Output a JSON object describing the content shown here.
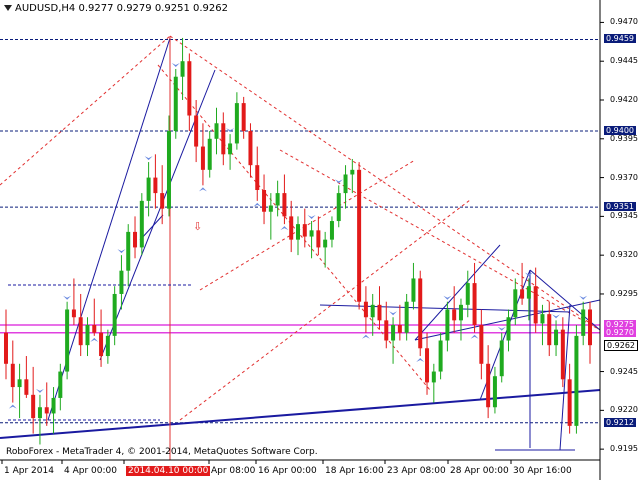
{
  "header": {
    "symbol_tf": "AUDUSD,H4",
    "ohlc": "0.9277 0.9279 0.9251 0.9262"
  },
  "footer": {
    "copyright": "RoboForex - MetaTrader 4, © 2001-2014, MetaQuotes Software Corp."
  },
  "xaxis": {
    "labels": [
      "1 Apr 2014",
      "4 Apr 00:00",
      "2014.04.10 00:00",
      "Apr 08:00",
      "16 Apr 00:00",
      "18 Apr 16:00",
      "23 Apr 08:00",
      "28 Apr 00:00",
      "30 Apr 16:00"
    ],
    "highlight_index": 2
  },
  "yaxis": {
    "ticks": [
      "0.9470",
      "0.9445",
      "0.9420",
      "0.9395",
      "0.9370",
      "0.9345",
      "0.9320",
      "0.9295",
      "0.9245",
      "0.9220",
      "0.9195"
    ],
    "levels": [
      {
        "price": "0.9459",
        "color": "#0a1c7a"
      },
      {
        "price": "0.9400",
        "color": "#0a1c7a"
      },
      {
        "price": "0.9351",
        "color": "#0a1c7a"
      },
      {
        "price": "0.9275",
        "color": "#e040e0"
      },
      {
        "price": "0.9270",
        "color": "#e040e0"
      },
      {
        "price": "0.9212",
        "color": "#0a1c7a"
      }
    ],
    "current": "0.9262"
  },
  "chart_data": {
    "type": "candlestick",
    "series": [
      {
        "name": "AUDUSD,H4",
        "ohlc": [
          [
            0.927,
            0.9285,
            0.924,
            0.925
          ],
          [
            0.925,
            0.9265,
            0.9225,
            0.9235
          ],
          [
            0.9235,
            0.925,
            0.9215,
            0.924
          ],
          [
            0.924,
            0.9255,
            0.9228,
            0.923
          ],
          [
            0.923,
            0.9248,
            0.9205,
            0.9215
          ],
          [
            0.9215,
            0.923,
            0.9198,
            0.9222
          ],
          [
            0.9222,
            0.9238,
            0.921,
            0.9218
          ],
          [
            0.9218,
            0.9235,
            0.9205,
            0.9228
          ],
          [
            0.9228,
            0.925,
            0.922,
            0.9245
          ],
          [
            0.9245,
            0.929,
            0.924,
            0.9285
          ],
          [
            0.9285,
            0.9305,
            0.9275,
            0.928
          ],
          [
            0.928,
            0.9295,
            0.9255,
            0.9262
          ],
          [
            0.9262,
            0.928,
            0.9255,
            0.9275
          ],
          [
            0.9275,
            0.9292,
            0.9268,
            0.927
          ],
          [
            0.927,
            0.9285,
            0.9248,
            0.9255
          ],
          [
            0.9255,
            0.9272,
            0.925,
            0.9268
          ],
          [
            0.9268,
            0.93,
            0.9262,
            0.9295
          ],
          [
            0.9295,
            0.932,
            0.9285,
            0.931
          ],
          [
            0.931,
            0.934,
            0.93,
            0.9335
          ],
          [
            0.9335,
            0.9345,
            0.9318,
            0.9325
          ],
          [
            0.9325,
            0.936,
            0.932,
            0.9355
          ],
          [
            0.9355,
            0.938,
            0.9345,
            0.937
          ],
          [
            0.937,
            0.9385,
            0.935,
            0.936
          ],
          [
            0.936,
            0.9378,
            0.934,
            0.935
          ],
          [
            0.935,
            0.941,
            0.9345,
            0.94
          ],
          [
            0.94,
            0.944,
            0.9395,
            0.9435
          ],
          [
            0.9435,
            0.946,
            0.942,
            0.9445
          ],
          [
            0.9445,
            0.945,
            0.94,
            0.941
          ],
          [
            0.941,
            0.942,
            0.938,
            0.939
          ],
          [
            0.939,
            0.9405,
            0.9365,
            0.9375
          ],
          [
            0.9375,
            0.94,
            0.937,
            0.9395
          ],
          [
            0.9395,
            0.9415,
            0.9385,
            0.9405
          ],
          [
            0.9405,
            0.9412,
            0.9378,
            0.9385
          ],
          [
            0.9385,
            0.9398,
            0.9375,
            0.9392
          ],
          [
            0.9392,
            0.9425,
            0.9388,
            0.9418
          ],
          [
            0.9418,
            0.9422,
            0.9395,
            0.94
          ],
          [
            0.94,
            0.9405,
            0.937,
            0.9378
          ],
          [
            0.9378,
            0.939,
            0.9355,
            0.9362
          ],
          [
            0.9362,
            0.9372,
            0.934,
            0.9348
          ],
          [
            0.9348,
            0.936,
            0.933,
            0.9352
          ],
          [
            0.9352,
            0.9368,
            0.9345,
            0.936
          ],
          [
            0.936,
            0.9372,
            0.934,
            0.9345
          ],
          [
            0.9345,
            0.9355,
            0.9322,
            0.933
          ],
          [
            0.933,
            0.9345,
            0.932,
            0.934
          ],
          [
            0.934,
            0.935,
            0.9325,
            0.9332
          ],
          [
            0.9332,
            0.9342,
            0.9318,
            0.9336
          ],
          [
            0.9336,
            0.9345,
            0.932,
            0.9325
          ],
          [
            0.9325,
            0.9335,
            0.9312,
            0.933
          ],
          [
            0.933,
            0.9345,
            0.9325,
            0.9342
          ],
          [
            0.9342,
            0.9365,
            0.9338,
            0.936
          ],
          [
            0.936,
            0.9378,
            0.935,
            0.9372
          ],
          [
            0.9372,
            0.9382,
            0.936,
            0.9375
          ],
          [
            0.9375,
            0.938,
            0.9285,
            0.929
          ],
          [
            0.929,
            0.93,
            0.927,
            0.928
          ],
          [
            0.928,
            0.9295,
            0.9268,
            0.9288
          ],
          [
            0.9288,
            0.93,
            0.9272,
            0.9278
          ],
          [
            0.9278,
            0.929,
            0.926,
            0.9265
          ],
          [
            0.9265,
            0.928,
            0.925,
            0.9275
          ],
          [
            0.9275,
            0.9288,
            0.9265,
            0.927
          ],
          [
            0.927,
            0.9295,
            0.9265,
            0.929
          ],
          [
            0.929,
            0.9315,
            0.9285,
            0.9305
          ],
          [
            0.9305,
            0.931,
            0.9255,
            0.926
          ],
          [
            0.926,
            0.927,
            0.923,
            0.9238
          ],
          [
            0.9238,
            0.925,
            0.9225,
            0.9245
          ],
          [
            0.9245,
            0.927,
            0.924,
            0.9265
          ],
          [
            0.9265,
            0.929,
            0.9258,
            0.9285
          ],
          [
            0.9285,
            0.93,
            0.927,
            0.9278
          ],
          [
            0.9278,
            0.9292,
            0.9265,
            0.9288
          ],
          [
            0.9288,
            0.931,
            0.928,
            0.9302
          ],
          [
            0.9302,
            0.9315,
            0.927,
            0.9275
          ],
          [
            0.9275,
            0.9285,
            0.924,
            0.925
          ],
          [
            0.925,
            0.9262,
            0.9215,
            0.9222
          ],
          [
            0.9222,
            0.9248,
            0.9218,
            0.9242
          ],
          [
            0.9242,
            0.927,
            0.9238,
            0.9265
          ],
          [
            0.9265,
            0.9285,
            0.9258,
            0.928
          ],
          [
            0.928,
            0.9305,
            0.9275,
            0.9298
          ],
          [
            0.9298,
            0.9315,
            0.9288,
            0.9292
          ],
          [
            0.9292,
            0.9305,
            0.9278,
            0.93
          ],
          [
            0.93,
            0.9312,
            0.927,
            0.9276
          ],
          [
            0.9276,
            0.9288,
            0.9262,
            0.9282
          ],
          [
            0.9282,
            0.929,
            0.9255,
            0.9262
          ],
          [
            0.9262,
            0.9278,
            0.9255,
            0.9272
          ],
          [
            0.9272,
            0.928,
            0.9235,
            0.924
          ],
          [
            0.924,
            0.925,
            0.9205,
            0.921
          ],
          [
            0.921,
            0.9275,
            0.9205,
            0.9268
          ],
          [
            0.9268,
            0.929,
            0.9262,
            0.9285
          ],
          [
            0.9285,
            0.929,
            0.925,
            0.9262
          ]
        ]
      }
    ]
  }
}
